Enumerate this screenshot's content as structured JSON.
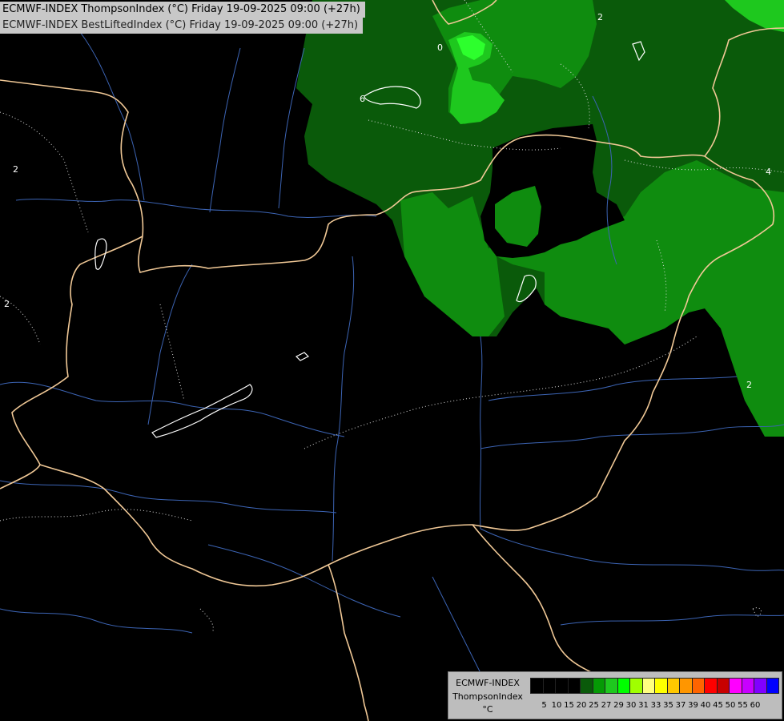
{
  "header": {
    "line1": "ECMWF-INDEX ThompsonIndex (°C) Friday 19-09-2025 09:00 (+27h)",
    "line2": "ECMWF-INDEX BestLiftedIndex (°C) Friday 19-09-2025 09:00 (+27h)"
  },
  "legend": {
    "model": "ECMWF-INDEX",
    "param": "ThompsonIndex",
    "unit": "°C",
    "ticks": [
      "5",
      "10",
      "15",
      "20",
      "25",
      "27",
      "29",
      "30",
      "31",
      "33",
      "35",
      "37",
      "39",
      "40",
      "45",
      "50",
      "55",
      "60"
    ],
    "colors": [
      "#000000",
      "#000000",
      "#000000",
      "#000000",
      "#0a5a0a",
      "#059a05",
      "#1ec81e",
      "#00ff00",
      "#a0ff00",
      "#ffff80",
      "#ffff00",
      "#ffc800",
      "#ff9600",
      "#ff6400",
      "#ff0000",
      "#c80000",
      "#ff00ff",
      "#c800ff",
      "#8000ff",
      "#0000ff"
    ]
  },
  "contour_labels": [
    "2",
    "2",
    "2",
    "4",
    "6",
    "0",
    "2"
  ]
}
